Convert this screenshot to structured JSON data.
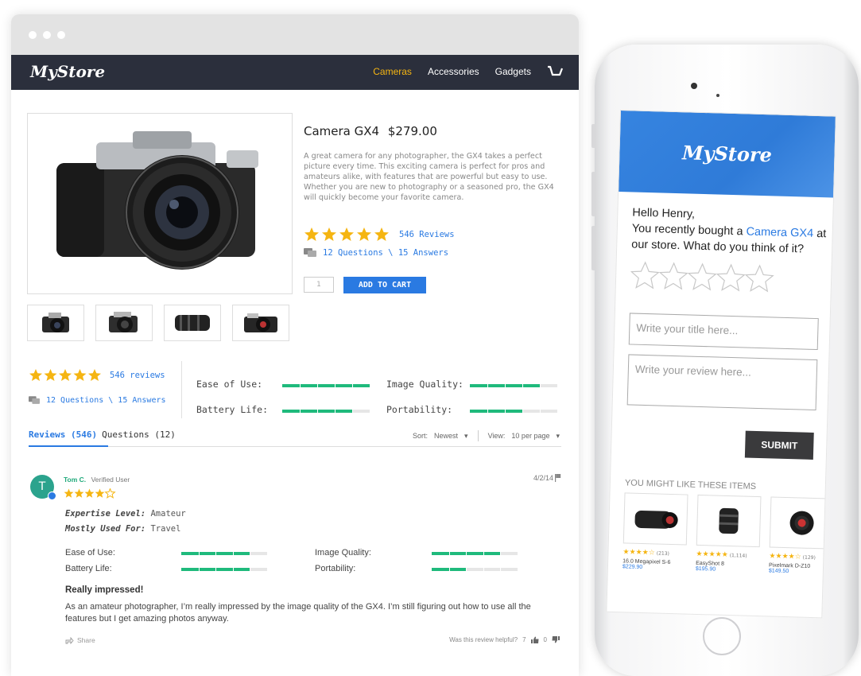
{
  "colors": {
    "accent": "#2a7ae2",
    "nav_bg": "#2b2f3c",
    "nav_active": "#f5b512",
    "star": "#f5b512",
    "bar_fill": "#1fba7c",
    "mobile_header": "#3684e0"
  },
  "desktop": {
    "nav": {
      "logo": "MyStore",
      "links": [
        "Cameras",
        "Accessories",
        "Gadgets"
      ],
      "active": "Cameras",
      "cart_icon": "cart-icon"
    },
    "product": {
      "name": "Camera GX4",
      "price": "$279.00",
      "description": "A great camera for any photographer, the GX4 takes a perfect picture every time. This exciting camera is perfect for pros and amateurs alike, with features that are powerful but easy to use. Whether you are new to photography or a seasoned pro, the GX4 will quickly become your favorite camera.",
      "rating": 5,
      "reviews_link": "546 Reviews",
      "qa_link": "12 Questions \\ 15 Answers",
      "quantity_placeholder": "1",
      "add_to_cart": "ADD TO CART",
      "thumbnail_count": 4
    },
    "summary": {
      "rating": 5,
      "reviews_link": "546 reviews",
      "qa_link": "12 Questions \\ 15 Answers",
      "metrics": [
        {
          "label": "Ease of Use:",
          "value": 1.0
        },
        {
          "label": "Image Quality:",
          "value": 0.8
        },
        {
          "label": "Battery Life:",
          "value": 0.8
        },
        {
          "label": "Portability:",
          "value": 0.6
        }
      ]
    },
    "tabs": {
      "reviews": "Reviews",
      "reviews_count": "(546)",
      "questions": "Questions (12)"
    },
    "sort": {
      "sort_label": "Sort:",
      "sort_value": "Newest",
      "view_label": "View:",
      "view_value": "10 per page"
    },
    "review": {
      "avatar_letter": "T",
      "name": "Tom C.",
      "badge": "Verified User",
      "rating": 4,
      "date": "4/2/14",
      "expertise_label": "Expertise Level:",
      "expertise_value": "Amateur",
      "used_for_label": "Mostly Used For:",
      "used_for_value": "Travel",
      "metrics": [
        {
          "label": "Ease of Use:",
          "value": 0.8
        },
        {
          "label": "Image Quality:",
          "value": 0.8
        },
        {
          "label": "Battery Life:",
          "value": 0.8
        },
        {
          "label": "Portability:",
          "value": 0.4
        }
      ],
      "title": "Really impressed!",
      "body": "As an amateur photographer, I’m really impressed by the image quality of the GX4. I’m still figuring out how to use all the features but I get amazing photos anyway.",
      "share": "Share",
      "helpful_text": "Was this review helpful?",
      "helpful_yes": "7",
      "helpful_no": "0"
    }
  },
  "mobile": {
    "logo": "MyStore",
    "greeting": "Hello Henry,",
    "message_before": "You recently bought a ",
    "product_link": "Camera GX4",
    "message_after": " at our store. What do you think of it?",
    "empty_stars": 5,
    "title_placeholder": "Write your title here...",
    "review_placeholder": "Write your review here...",
    "submit": "SUBMIT",
    "recommend_heading": "YOU MIGHT LIKE THESE ITEMS",
    "products": [
      {
        "name": "16.0 Megapixel S-6",
        "price": "$229.90",
        "rating": 4,
        "count": "(213)"
      },
      {
        "name": "EasyShot 8",
        "price": "$195.90",
        "rating": 5,
        "count": "(1,114)"
      },
      {
        "name": "Pixelmark D-Z10",
        "price": "$149.50",
        "rating": 4,
        "count": "(129)"
      }
    ]
  }
}
